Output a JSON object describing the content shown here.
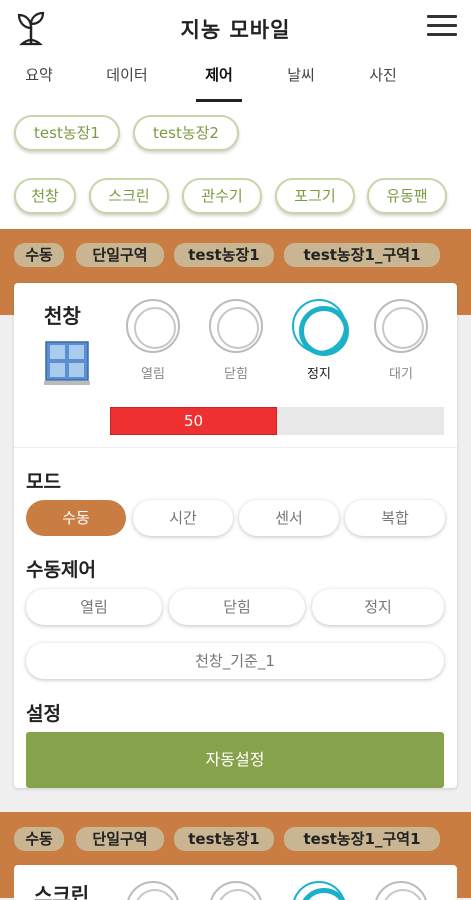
{
  "header": {
    "title": "지농  모바일",
    "logo_icon": "sprout-icon",
    "menu_icon": "hamburger-menu-icon"
  },
  "tabs": [
    {
      "label": "요약",
      "active": false
    },
    {
      "label": "데이터",
      "active": false
    },
    {
      "label": "제어",
      "active": true
    },
    {
      "label": "날씨",
      "active": false
    },
    {
      "label": "사진",
      "active": false
    }
  ],
  "farms": [
    "test농장1",
    "test농장2"
  ],
  "devices": [
    "천창",
    "스크린",
    "관수기",
    "포그기",
    "유동팬"
  ],
  "colors": {
    "accent_brown": "#c97d42",
    "accent_green": "#86a24a",
    "cyan": "#1bb2c9",
    "progress_red": "#ef3030"
  },
  "panel1": {
    "tags": [
      "수동",
      "단일구역",
      "test농장1",
      "test농장1_구역1"
    ],
    "title": "천창",
    "icon": "window-icon",
    "states": [
      {
        "label": "열림",
        "selected": false
      },
      {
        "label": "닫힘",
        "selected": false
      },
      {
        "label": "정지",
        "selected": true
      },
      {
        "label": "대기",
        "selected": false
      }
    ],
    "progress": {
      "value": 50,
      "max": 100,
      "label": "50"
    },
    "mode": {
      "label": "모드",
      "options": [
        "수동",
        "시간",
        "센서",
        "복합"
      ],
      "selected": "수동"
    },
    "manual": {
      "label": "수동제어",
      "buttons": [
        "열림",
        "닫힘",
        "정지"
      ],
      "reference": "천창_기준_1"
    },
    "settings": {
      "label": "설정",
      "button": "자동설정"
    }
  },
  "panel2": {
    "tags": [
      "수동",
      "단일구역",
      "test농장1",
      "test농장1_구역1"
    ],
    "title": "스크린"
  }
}
